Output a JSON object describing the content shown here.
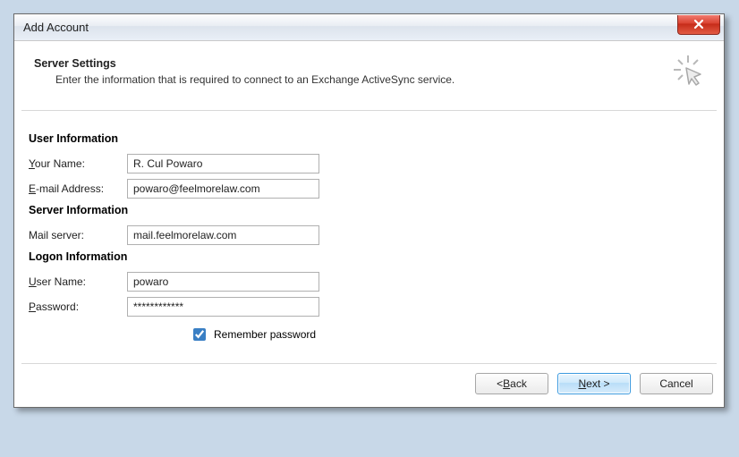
{
  "title": "Add Account",
  "header": {
    "title": "Server Settings",
    "subtitle": "Enter the information that is required to connect to an Exchange ActiveSync service."
  },
  "sections": {
    "user_info": "User Information",
    "server_info": "Server Information",
    "logon_info": "Logon Information"
  },
  "labels": {
    "your_name_pre": "Y",
    "your_name_post": "our Name:",
    "email_pre": "E",
    "email_post": "-mail Address:",
    "mail_server": "Mail server:",
    "user_name_pre": "U",
    "user_name_post": "ser Name:",
    "password_pre": "P",
    "password_post": "assword:",
    "remember_pre": "R",
    "remember_post": "emember password"
  },
  "values": {
    "your_name": "R. Cul Powaro",
    "email": "powaro@feelmorelaw.com",
    "mail_server": "mail.feelmorelaw.com",
    "user_name": "powaro",
    "password": "************",
    "remember_checked": true
  },
  "buttons": {
    "back_pre": "< ",
    "back_u": "B",
    "back_post": "ack",
    "next_u": "N",
    "next_post": "ext >",
    "cancel": "Cancel"
  }
}
